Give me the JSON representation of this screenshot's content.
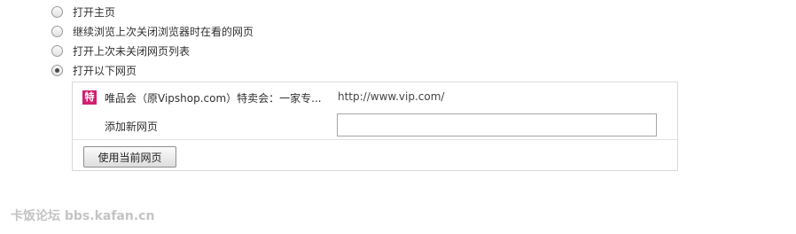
{
  "startup_options": {
    "items": [
      {
        "label": "打开主页",
        "checked": false
      },
      {
        "label": "继续浏览上次关闭浏览器时在看的网页",
        "checked": false
      },
      {
        "label": "打开上次未关闭网页列表",
        "checked": false
      },
      {
        "label": "打开以下网页",
        "checked": true
      }
    ]
  },
  "pages_panel": {
    "entries": [
      {
        "icon_char": "特",
        "icon_color": "#d0216f",
        "title": "唯品会（原Vipshop.com）特卖会：一家专...",
        "url": "http://www.vip.com/"
      }
    ],
    "add_label": "添加新网页",
    "add_input_value": "",
    "use_current_button": "使用当前网页"
  },
  "watermark": "卡饭论坛 bbs.kafan.cn"
}
